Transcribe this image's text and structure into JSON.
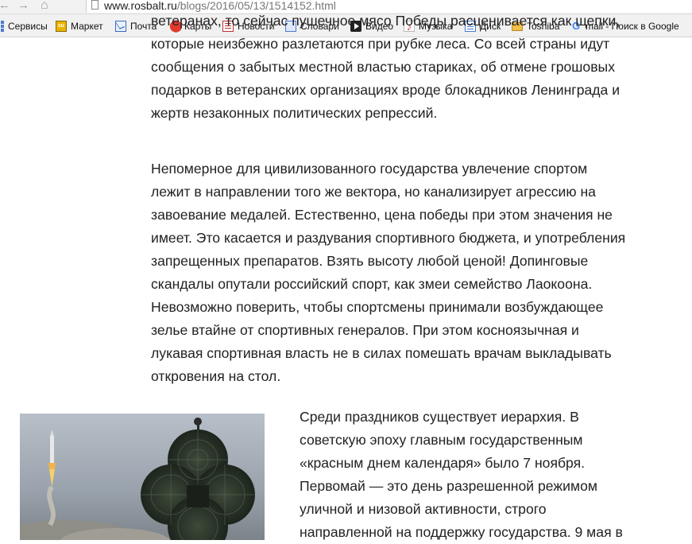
{
  "browser": {
    "nav": {
      "back": "←",
      "forward": "→",
      "home": "⌂"
    },
    "url_host": "www.rosbalt.ru",
    "url_path": "/blogs/2016/05/13/1514152.html"
  },
  "bookmarks": [
    {
      "label": "Сервисы",
      "icon": "apps-grid-icon"
    },
    {
      "label": "Маркет",
      "icon": "market-icon"
    },
    {
      "label": "Почта",
      "icon": "mail-icon"
    },
    {
      "label": "Карты",
      "icon": "map-pin-icon"
    },
    {
      "label": "Новости",
      "icon": "news-icon"
    },
    {
      "label": "Словари",
      "icon": "dictionary-icon"
    },
    {
      "label": "Видео",
      "icon": "video-icon"
    },
    {
      "label": "Музыка",
      "icon": "music-icon"
    },
    {
      "label": "Диск",
      "icon": "disk-icon"
    },
    {
      "label": "Toshiba",
      "icon": "folder-icon"
    },
    {
      "label": "mail - Поиск в Google",
      "icon": "google-icon"
    }
  ],
  "article": {
    "paragraph_1_cut_top": "ветеранах, то сейчас пушечное мясо Победы расценивается как щепки,",
    "paragraph_1": [
      "которые неизбежно разлетаются при рубке леса. Со всей страны идут",
      "сообщения о забытых местной властью стариках, об отмене грошовых",
      "подарков в ветеранских организациях вроде блокадников Ленинграда и",
      "жертв незаконных политических репрессий."
    ],
    "paragraph_2": [
      "Непомерное для цивилизованного государства увлечение спортом",
      "лежит в направлении того же вектора, но канализирует агрессию на",
      "завоевание медалей. Естественно, цена победы при этом значения не",
      "имеет. Это касается и раздувания спортивного бюджета, и употребления",
      "запрещенных препаратов. Взять высоту любой ценой! Допинговые",
      "скандалы опутали российский спорт, как змеи семейство Лаокоона.",
      "Невозможно поверить, чтобы спортсмены принимали возбуждающее",
      "зелье втайне от спортивных генералов. При этом косноязычная и",
      "лукавая спортивная власть не в силах помешать врачам выкладывать",
      "откровения на стол."
    ],
    "paragraph_3": [
      "Среди праздников существует иерархия. В",
      "советскую эпоху главным государственным",
      "«красным днем календаря» было 7 ноября.",
      "Первомай — это день разрешенной режимом",
      "уличной и низовой активности, строго",
      "направленной на поддержку государства. 9 мая в"
    ]
  },
  "colors": {
    "text": "#222222",
    "background": "#ffffff",
    "toolbar": "#f1f1f1"
  }
}
